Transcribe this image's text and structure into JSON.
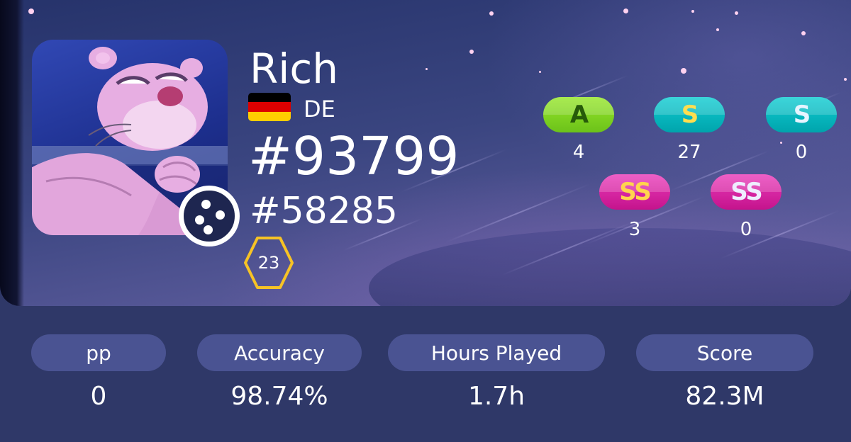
{
  "profile": {
    "username": "Rich",
    "country_code": "DE",
    "flag_icon": "germany-flag-icon",
    "flag_colors": [
      "#000000",
      "#dd0000",
      "#ffce00"
    ],
    "global_rank": "#93799",
    "country_rank": "#58285",
    "level": "23",
    "avatar_icon": "pink-panther-avatar",
    "mode_icon": "osu-standard-mode-icon"
  },
  "grades": [
    {
      "label": "A",
      "count": "4",
      "colors": [
        "#88da20",
        "#6bc01a"
      ],
      "text_color": "#275a0a"
    },
    {
      "label": "S",
      "count": "27",
      "colors": [
        "#02c1c8",
        "#00a6ae"
      ],
      "text_color": "#ffde4f"
    },
    {
      "label": "S",
      "count": "0",
      "colors": [
        "#02c1c8",
        "#00a6ae"
      ],
      "text_color": "#e6f4ff"
    },
    {
      "label": "SS",
      "count": "3",
      "colors": [
        "#e02fae",
        "#c7158f"
      ],
      "text_color": "#ffd54d"
    },
    {
      "label": "SS",
      "count": "0",
      "colors": [
        "#e02fae",
        "#c7158f"
      ],
      "text_color": "#eeeeff"
    }
  ],
  "stats": {
    "pp": {
      "label": "pp",
      "value": "0"
    },
    "accuracy": {
      "label": "Accuracy",
      "value": "98.74%"
    },
    "hours_played": {
      "label": "Hours Played",
      "value": "1.7h"
    },
    "score": {
      "label": "Score",
      "value": "82.3M"
    }
  },
  "colors": {
    "background": "#2f3868",
    "stat_pill": "#4a5392",
    "level_badge": "#f7c325"
  }
}
